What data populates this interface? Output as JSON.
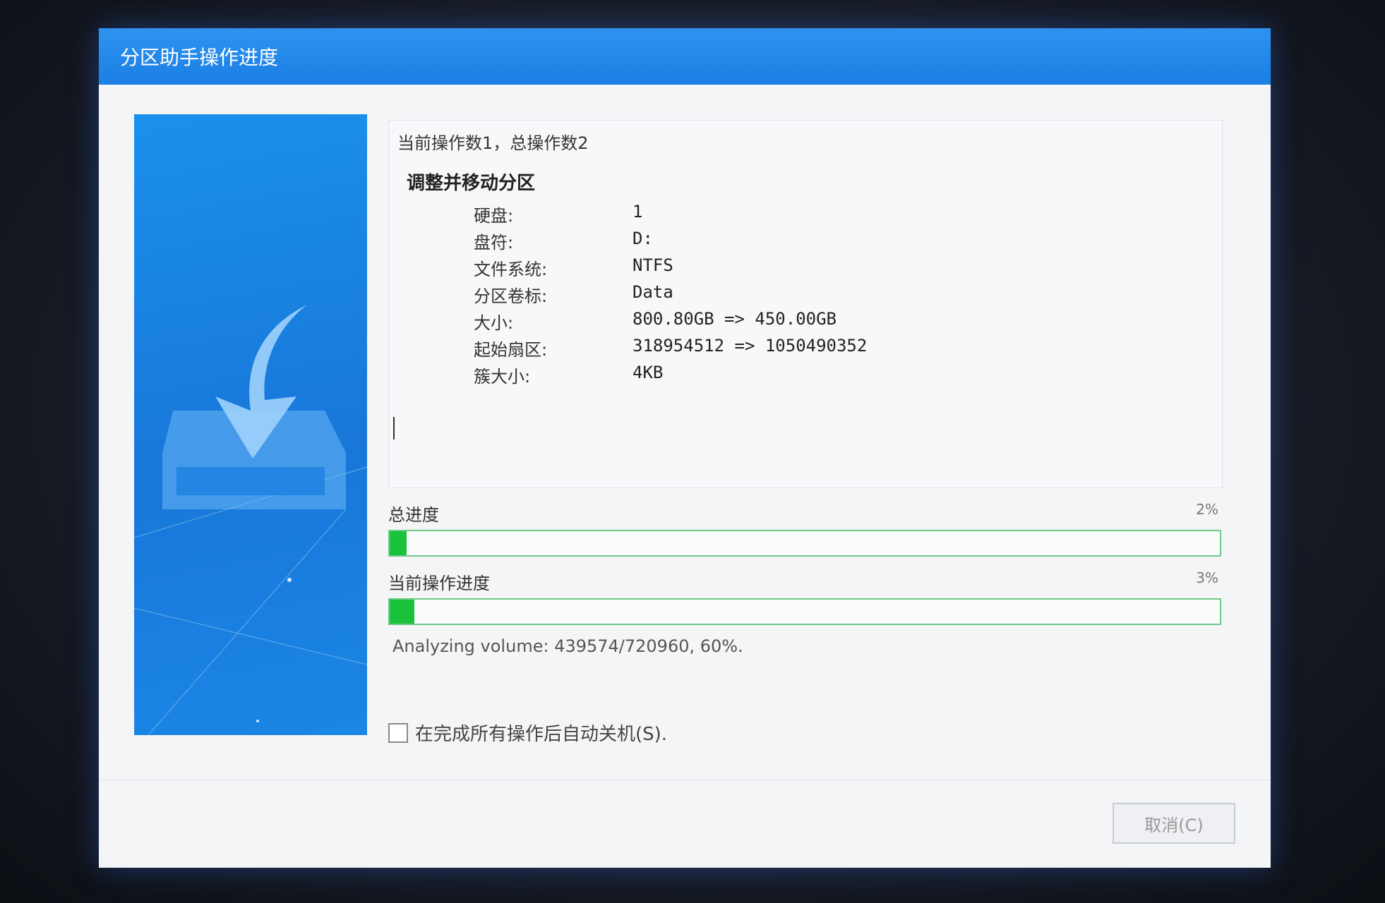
{
  "window": {
    "title": "分区助手操作进度"
  },
  "operation": {
    "counter": "当前操作数1，总操作数2",
    "title": "调整并移动分区",
    "details": [
      {
        "label": "硬盘:",
        "value": "1"
      },
      {
        "label": "盘符:",
        "value": "D:"
      },
      {
        "label": "文件系统:",
        "value": "NTFS"
      },
      {
        "label": "分区卷标:",
        "value": "Data"
      },
      {
        "label": "大小:",
        "value": "800.80GB => 450.00GB"
      },
      {
        "label": "起始扇区:",
        "value": "318954512 => 1050490352"
      },
      {
        "label": "簇大小:",
        "value": "4KB"
      }
    ]
  },
  "progress": {
    "total_label": "总进度",
    "total_percent_text": "2%",
    "total_fraction": 0.02,
    "current_label": "当前操作进度",
    "current_percent_text": "3%",
    "current_fraction": 0.03,
    "status": "Analyzing volume: 439574/720960, 60%."
  },
  "shutdown_checkbox": {
    "label": "在完成所有操作后自动关机(S).",
    "checked": false
  },
  "buttons": {
    "cancel": "取消(C)"
  },
  "colors": {
    "title_bar": "#1b7fe4",
    "banner": "#1877d9",
    "progress_fill": "#19c23a"
  }
}
